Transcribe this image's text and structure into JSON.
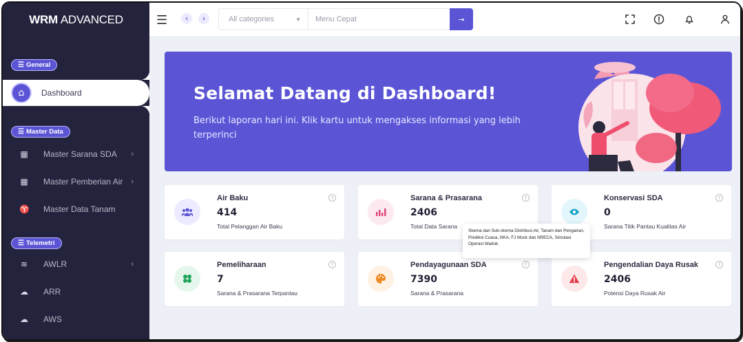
{
  "brand": {
    "bold": "WRM",
    "light": "ADVANCED"
  },
  "sidebar": {
    "groups": {
      "general": "General",
      "master_data": "Master Data",
      "telemetri": "Telemetri"
    },
    "active": {
      "label": "Dashboard",
      "icon": "home-icon"
    },
    "items": [
      {
        "label": "Master Sarana SDA",
        "icon": "building-icon",
        "has_children": true
      },
      {
        "label": "Master Pemberian Air",
        "icon": "building-icon",
        "has_children": true
      },
      {
        "label": "Master Data Tanam",
        "icon": "sprout-icon",
        "has_children": false
      },
      {
        "label": "AWLR",
        "icon": "water-level-icon",
        "has_children": true
      },
      {
        "label": "ARR",
        "icon": "rain-cloud-icon",
        "has_children": false
      },
      {
        "label": "AWS",
        "icon": "weather-cloud-icon",
        "has_children": false
      }
    ]
  },
  "topbar": {
    "category_select": "All categories",
    "search_placeholder": "Menu Cepat"
  },
  "banner": {
    "title": "Selamat Datang di Dashboard!",
    "subtitle": "Berikut laporan hari ini. Klik kartu untuk mengakses informasi yang lebih terperinci"
  },
  "cards": [
    {
      "title": "Air Baku",
      "value": "414",
      "subtitle": "Total Pelanggan Air Baku",
      "icon": "users-icon",
      "color": "#5b55d6",
      "bg": "#ecebff"
    },
    {
      "title": "Sarana & Prasarana",
      "value": "2406",
      "subtitle": "Total Data Sarana",
      "icon": "bar-chart-icon",
      "color": "#e0457b",
      "bg": "#fde9f0"
    },
    {
      "title": "Konservasi SDA",
      "value": "0",
      "subtitle": "Sarana Titik Pantau Kualitas Air",
      "icon": "eye-icon",
      "color": "#12a4c9",
      "bg": "#e3f6fb"
    },
    {
      "title": "Pemeliharaan",
      "value": "7",
      "subtitle": "Sarana & Prasarana Terpantau",
      "icon": "clover-icon",
      "color": "#1fa35b",
      "bg": "#e5f7ec"
    },
    {
      "title": "Pendayagunaan SDA",
      "value": "7390",
      "subtitle": "Sarana & Prasarana",
      "icon": "palette-icon",
      "color": "#f08a24",
      "bg": "#fff1e3"
    },
    {
      "title": "Pengendalian Daya Rusak",
      "value": "2406",
      "subtitle": "Potensi Daya Rusak Air",
      "icon": "warning-icon",
      "color": "#e23b4a",
      "bg": "#fde8ea"
    }
  ],
  "tooltip": "Skema dan Sub-skema Distribusi Air, Tanam dan Pengairan, Prediksi Cuaca, NKA, FJ Mock dan NRECA, Simulasi Operasi Waduk."
}
